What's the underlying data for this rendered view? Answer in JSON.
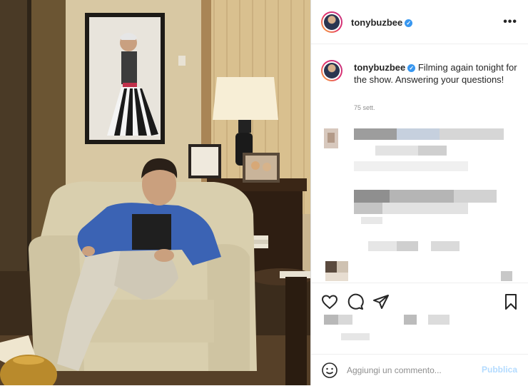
{
  "post": {
    "username": "tonybuzbee",
    "verified_icon": "verified-badge-icon",
    "caption": "Filming again tonight for the show. Answering your questions!",
    "timestamp": "75 sett.",
    "more_icon": "more-options-icon"
  },
  "actions": {
    "like_icon": "heart-icon",
    "comment_icon": "comment-bubble-icon",
    "share_icon": "paper-plane-icon",
    "save_icon": "bookmark-icon"
  },
  "comment_box": {
    "emoji_icon": "emoji-icon",
    "placeholder": "Aggiungi un commento...",
    "post_label": "Pubblica"
  },
  "colors": {
    "accent": "#3897f0",
    "post_disabled": "#b3dbff",
    "text": "#262626",
    "muted": "#8e8e8e"
  }
}
